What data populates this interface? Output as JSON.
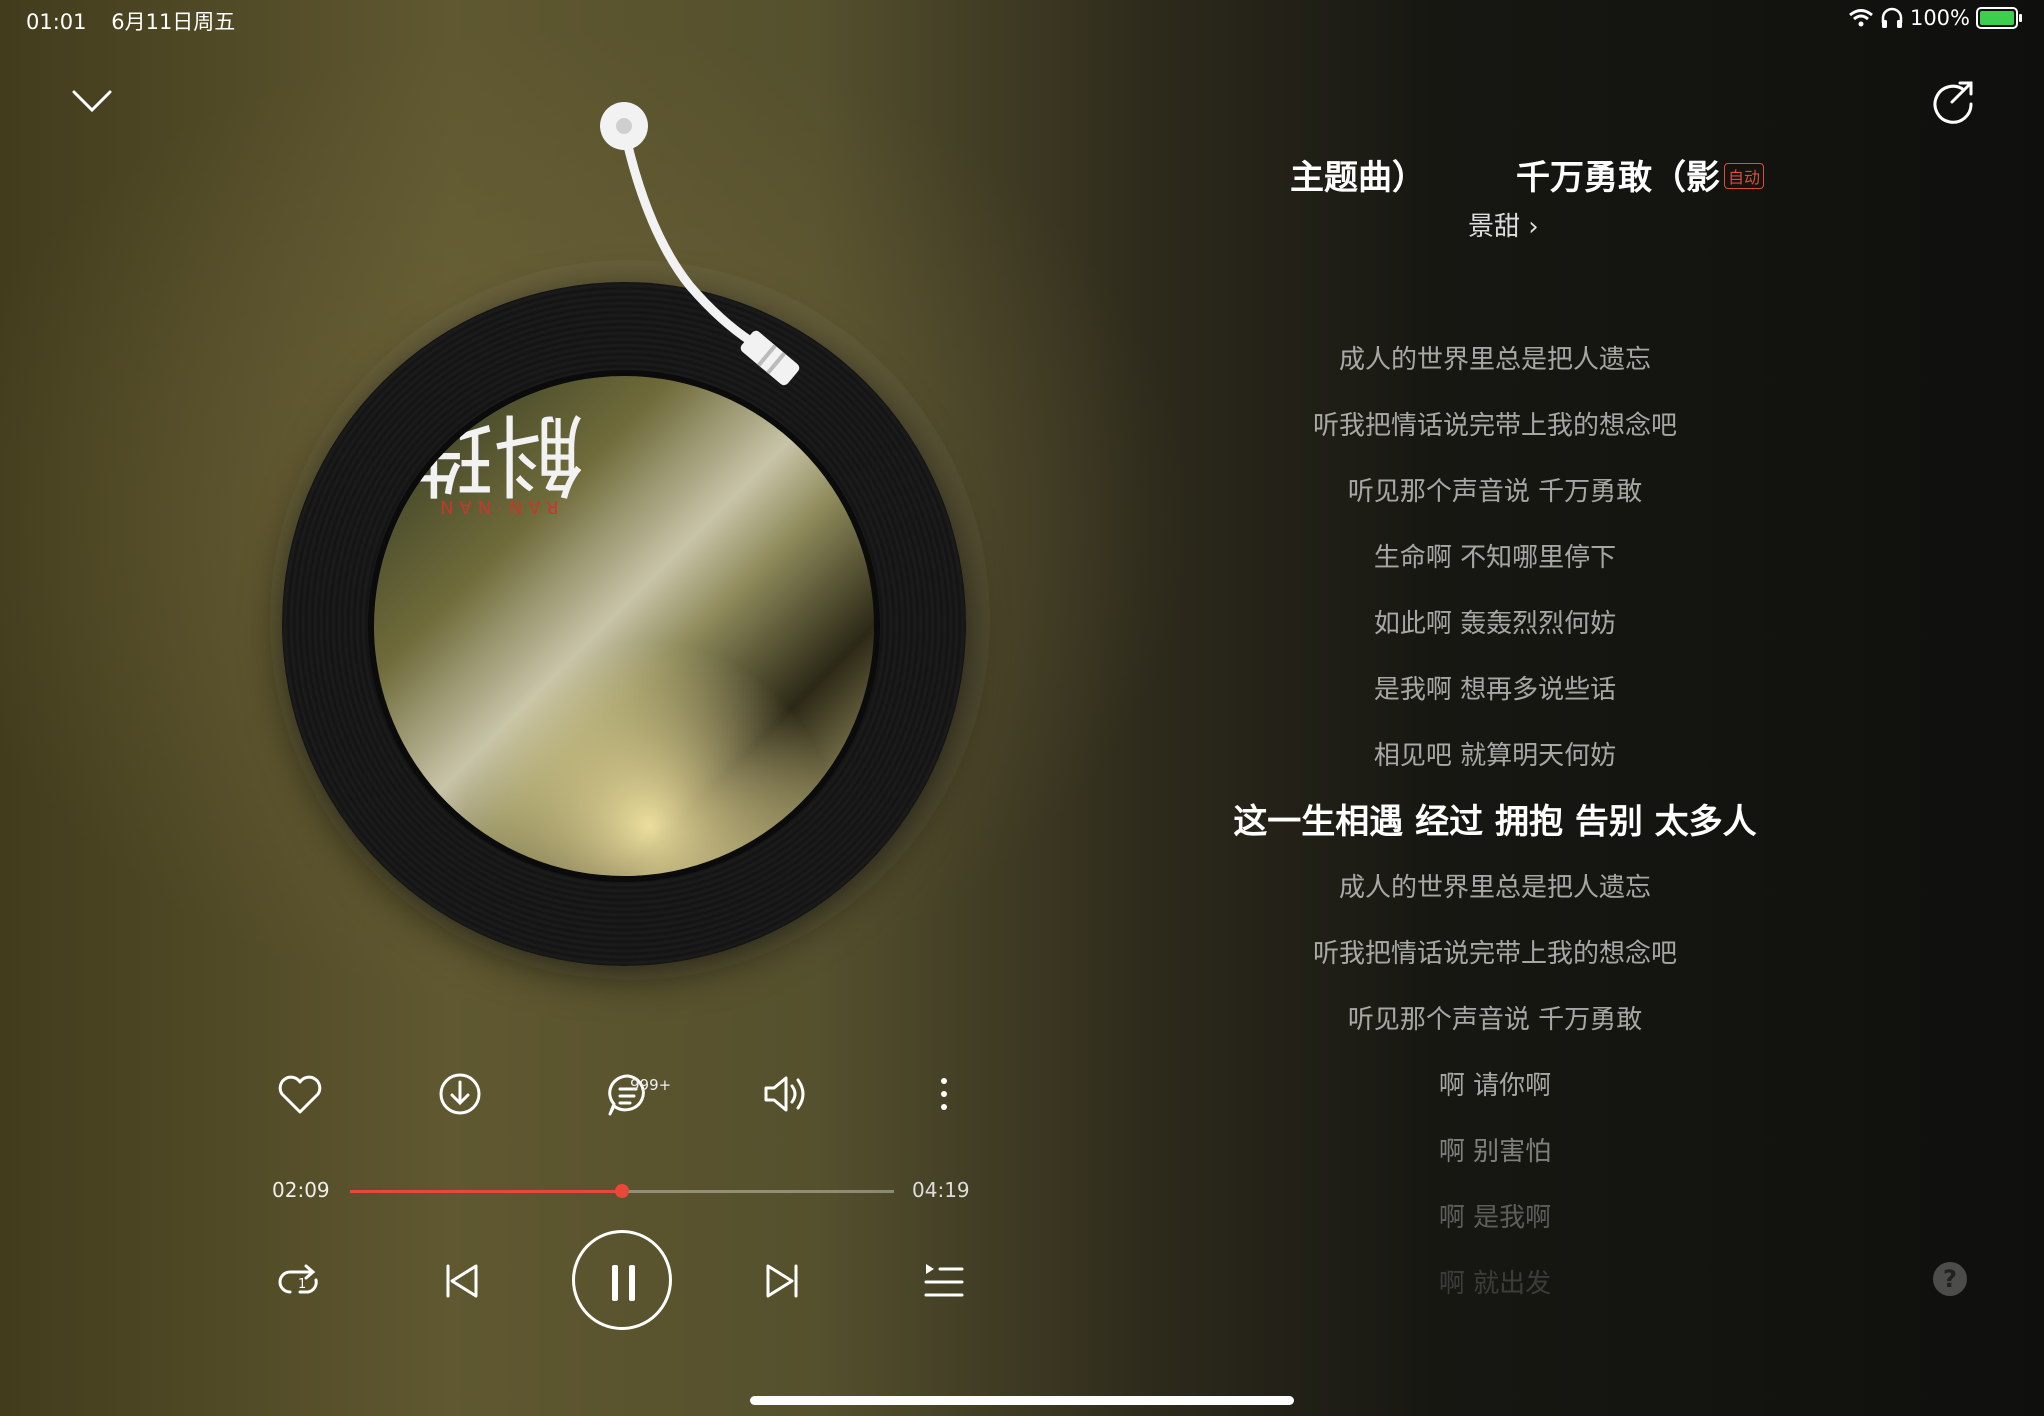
{
  "status_bar": {
    "time": "01:01",
    "date": "6月11日周五",
    "battery": "100%"
  },
  "song": {
    "title_part1": "主题曲）",
    "title_part2": "千万勇敢（影",
    "auto_tag": "自动",
    "artist": "景甜 ›"
  },
  "cover": {
    "title": "斛珠",
    "subtitle": "RAN·NAN"
  },
  "actions": {
    "comment_count": "999+"
  },
  "playback": {
    "current_time": "02:09",
    "total_time": "04:19",
    "progress": 0.5
  },
  "lyrics": [
    "成人的世界里总是把人遗忘",
    "听我把情话说完带上我的想念吧",
    "听见那个声音说 千万勇敢",
    "生命啊 不知哪里停下",
    "如此啊 轰轰烈烈何妨",
    "是我啊 想再多说些话",
    "相见吧 就算明天何妨",
    "这一生相遇 经过 拥抱 告别 太多人",
    "成人的世界里总是把人遗忘",
    "听我把情话说完带上我的想念吧",
    "听见那个声音说 千万勇敢",
    "啊 请你啊",
    "啊 别害怕",
    "啊 是我啊",
    "啊 就出发"
  ],
  "current_lyric_index": 7,
  "colors": {
    "accent": "#e8483a",
    "background": "#3a361f"
  }
}
